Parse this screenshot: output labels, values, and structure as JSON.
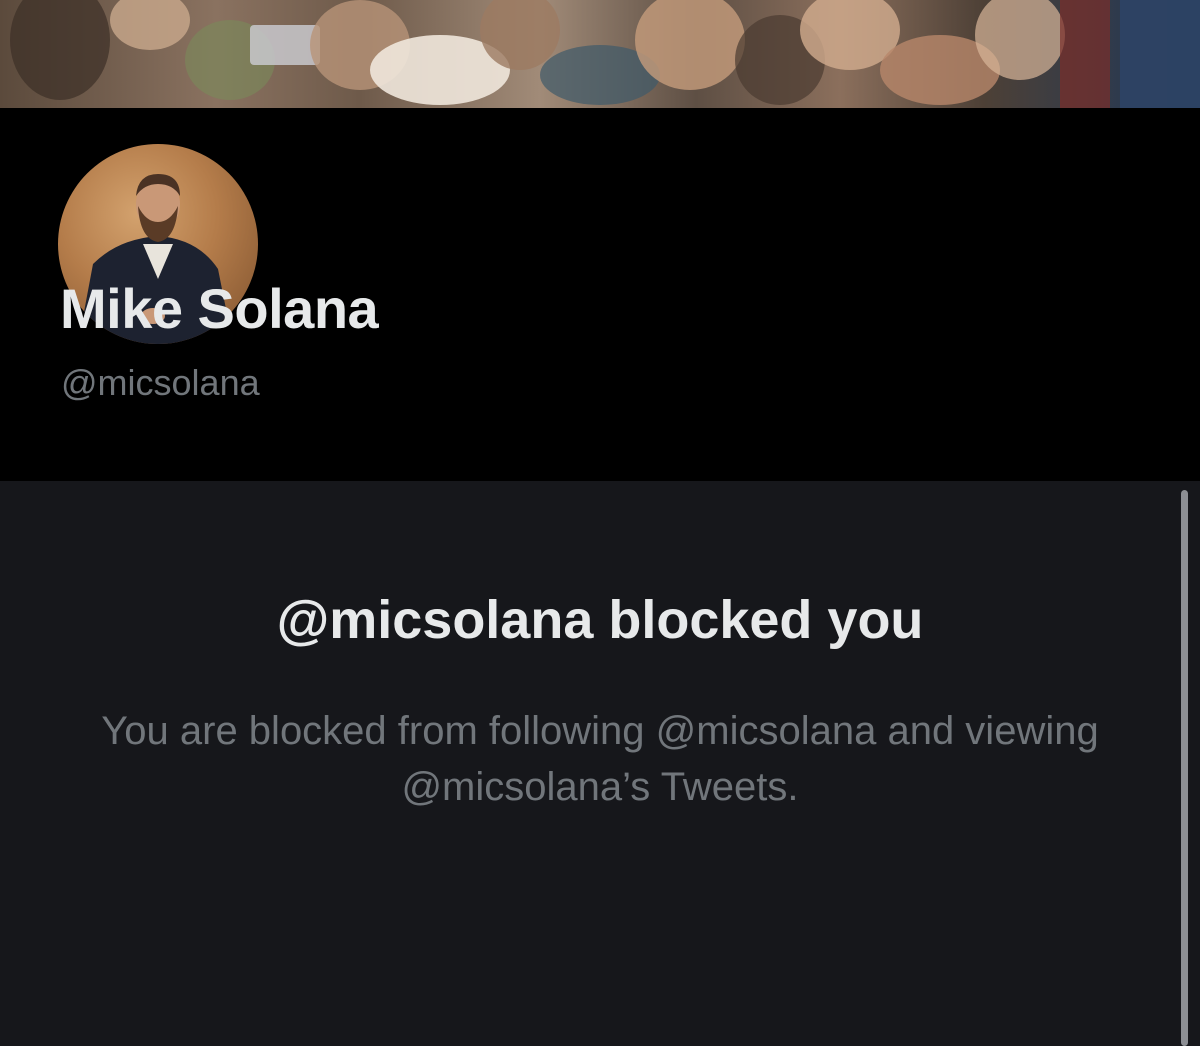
{
  "profile": {
    "banner_icon": "painting-banner-image",
    "avatar_icon": "portrait-avatar-image",
    "display_name": "Mike Solana",
    "handle": "@micsolana"
  },
  "blocked_notice": {
    "title": "@micsolana blocked you",
    "message": "You are blocked from following @micsolana and viewing @micsolana’s Tweets."
  },
  "colors": {
    "background": "#000000",
    "panel_background": "#16171b",
    "primary_text": "#e7e9ea",
    "secondary_text": "#71767b"
  }
}
